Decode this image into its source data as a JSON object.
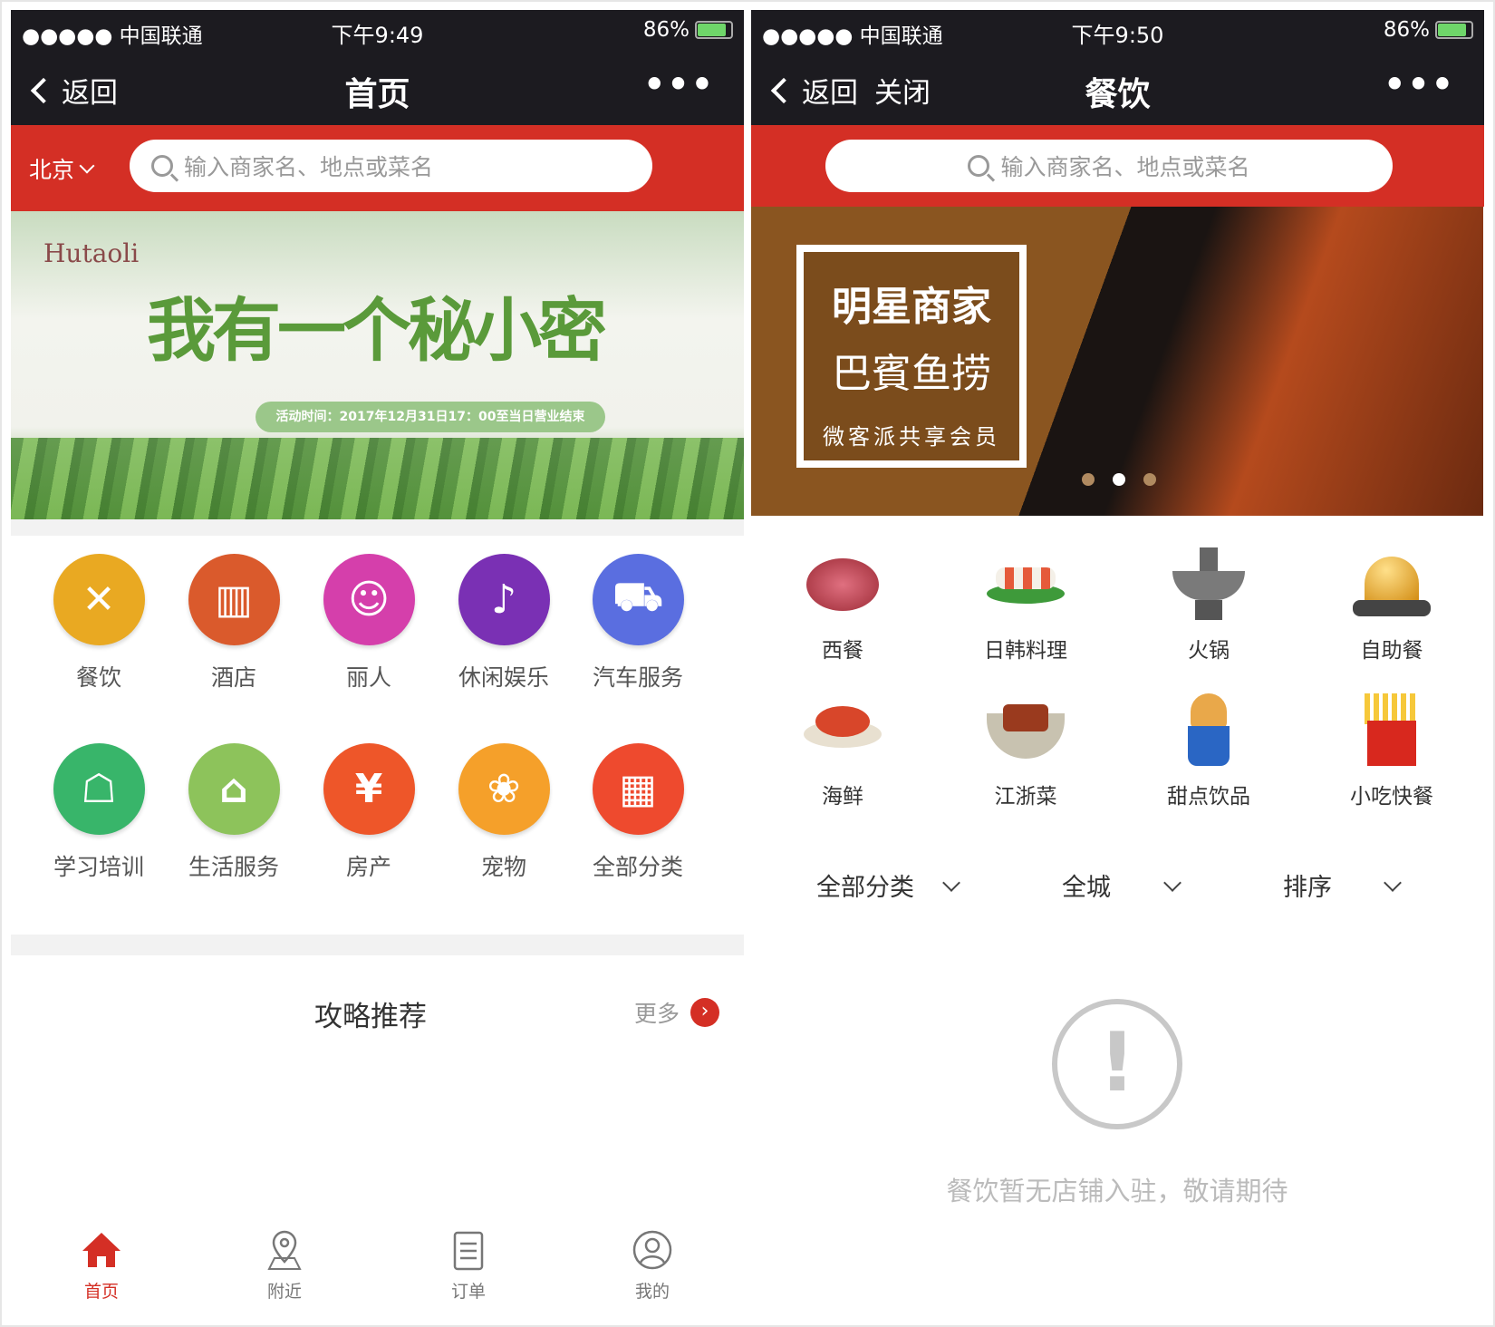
{
  "left": {
    "status": {
      "carrier": "●●●●● 中国联通",
      "time": "下午9:49",
      "battery": "86%",
      "battery_level": 0.86
    },
    "nav": {
      "back": "返回",
      "title": "首页",
      "more": "•••"
    },
    "city": "北京",
    "search_placeholder": "输入商家名、地点或菜名",
    "banner": {
      "logo": "Hutaoli",
      "headline": "我有一个秘小密",
      "event": "活动时间：2017年12月31日17：00至当日营业结束"
    },
    "categories": [
      {
        "label": "餐饮",
        "icon": "fork-knife-icon",
        "color": "#e9a922"
      },
      {
        "label": "酒店",
        "icon": "building-icon",
        "color": "#da5a2c"
      },
      {
        "label": "丽人",
        "icon": "beauty-icon",
        "color": "#d53fab"
      },
      {
        "label": "休闲娱乐",
        "icon": "microphone-icon",
        "color": "#7a30b4"
      },
      {
        "label": "汽车服务",
        "icon": "car-icon",
        "color": "#5a6ee0"
      },
      {
        "label": "学习培训",
        "icon": "teacher-icon",
        "color": "#38b56a"
      },
      {
        "label": "生活服务",
        "icon": "home-heart-icon",
        "color": "#8dc35b"
      },
      {
        "label": "房产",
        "icon": "house-yen-icon",
        "color": "#ee5629"
      },
      {
        "label": "宠物",
        "icon": "paw-icon",
        "color": "#f5a02a"
      },
      {
        "label": "全部分类",
        "icon": "grid-icon",
        "color": "#ee4a2e"
      }
    ],
    "guide": {
      "title": "攻略推荐",
      "more": "更多"
    },
    "tabs": [
      {
        "label": "首页",
        "icon": "home-icon",
        "active": true
      },
      {
        "label": "附近",
        "icon": "location-icon",
        "active": false
      },
      {
        "label": "订单",
        "icon": "order-icon",
        "active": false
      },
      {
        "label": "我的",
        "icon": "user-icon",
        "active": false
      }
    ],
    "accent": "#d42f25"
  },
  "right": {
    "status": {
      "carrier": "●●●●● 中国联通",
      "time": "下午9:50",
      "battery": "86%",
      "battery_level": 0.86
    },
    "nav": {
      "back": "返回",
      "close": "关闭",
      "title": "餐饮",
      "more": "•••"
    },
    "search_placeholder": "输入商家名、地点或菜名",
    "banner": {
      "line1": "明星商家",
      "line2": "巴賓鱼捞",
      "line3": "微客派共享会员",
      "active_dot": 1,
      "dots": 3
    },
    "foods": [
      {
        "label": "西餐",
        "icon": "steak-icon"
      },
      {
        "label": "日韩料理",
        "icon": "sushi-icon"
      },
      {
        "label": "火锅",
        "icon": "hotpot-icon"
      },
      {
        "label": "自助餐",
        "icon": "service-bell-icon"
      },
      {
        "label": "海鲜",
        "icon": "lobster-icon"
      },
      {
        "label": "江浙菜",
        "icon": "braised-pork-icon"
      },
      {
        "label": "甜点饮品",
        "icon": "ice-cream-icon"
      },
      {
        "label": "小吃快餐",
        "icon": "fries-icon"
      }
    ],
    "filters": [
      "全部分类",
      "全城",
      "排序"
    ],
    "empty": "餐饮暂无店铺入驻，敬请期待"
  }
}
